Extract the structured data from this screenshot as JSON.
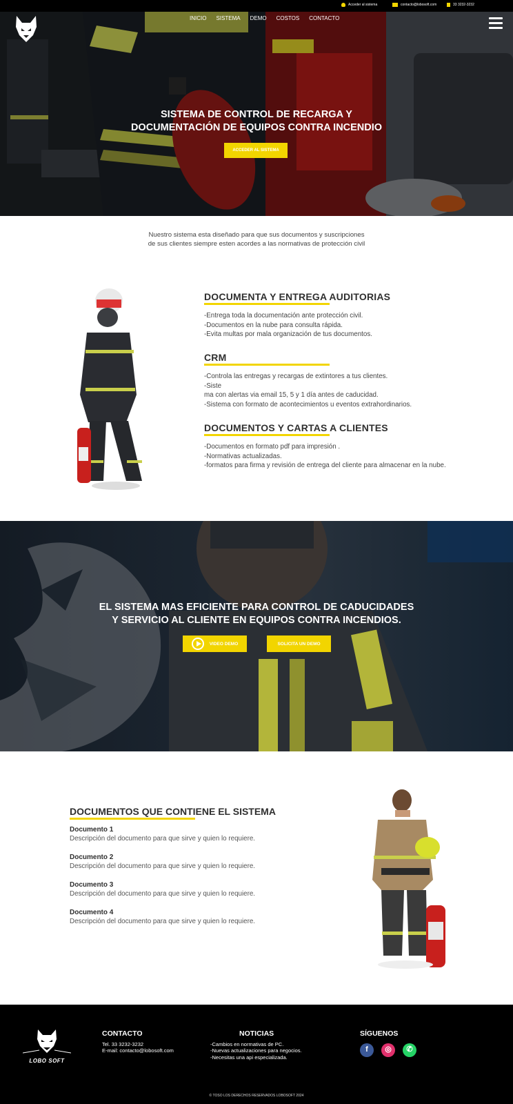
{
  "topbar": {
    "access": "Acceder al sistema",
    "email": "contacto@lobosoft.com",
    "phone": "33 3232-3232"
  },
  "nav": [
    "INICIO",
    "SISTEMA",
    "DEMO",
    "COSTOS",
    "CONTACTO"
  ],
  "hero": {
    "title_line1": "SISTEMA DE CONTROL DE RECARGA Y",
    "title_line2": "DOCUMENTACIÓN DE EQUIPOS CONTRA INCENDIO",
    "cta": "ACCEDER AL SISTEMA"
  },
  "intro": {
    "line1": "Nuestro sistema esta diseñado para que sus documentos y suscripciones",
    "line2": "de sus clientes siempre esten acordes a las normativas de protección civil"
  },
  "features": [
    {
      "title": "DOCUMENTA Y ENTREGA AUDITORIAS",
      "items": [
        "-Entrega toda la documentación ante protección civil.",
        "-Documentos en la nube para consulta rápida.",
        "-Evita multas por mala organización de tus documentos."
      ]
    },
    {
      "title": "CRM",
      "items": [
        "-Controla las entregas y recargas de extintores a tus clientes.",
        "-Siste",
        "ma con alertas via email 15, 5 y 1 día antes de caducidad.",
        "-Sistema con formato de acontecimientos u eventos extrahordinarios."
      ]
    },
    {
      "title": "DOCUMENTOS Y CARTAS A CLIENTES",
      "items": [
        "-Documentos en formato pdf para impresión .",
        "-Normativas actualizadas.",
        "-formatos para firma y revisión de entrega del cliente para almacenar en la nube."
      ]
    }
  ],
  "band": {
    "line1": "EL SISTEMA MAS EFICIENTE PARA CONTROL DE CADUCIDADES",
    "line2": "Y SERVICIO AL CLIENTE EN EQUIPOS CONTRA INCENDIOS.",
    "video_btn": "VIDEO DEMO",
    "demo_btn": "SOLICITA UN DEMO"
  },
  "docs": {
    "title": "DOCUMENTOS QUE CONTIENE EL SISTEMA",
    "items": [
      {
        "name": "Documento 1",
        "desc": "Descripción del documento para que sirve y quien lo requiere."
      },
      {
        "name": "Documento 2",
        "desc": "Descripción del documento para que sirve y quien lo requiere."
      },
      {
        "name": "Documento 3",
        "desc": "Descripción del documento para que sirve y quien lo requiere."
      },
      {
        "name": "Documento 4",
        "desc": "Descripción del documento para que sirve y quien lo requiere."
      }
    ]
  },
  "footer": {
    "logo_text": "LOBO SOFT",
    "contact_title": "CONTACTO",
    "contact_tel": "Tel. 33 3232-3232",
    "contact_email": "E-mail:  contacto@lobosoft.com",
    "news_title": "NOTICIAS",
    "news_items": [
      "-Cambios en normativas de PC.",
      "-Nuevas actualizaciones para negocios.",
      "-Necesitas una api especializada."
    ],
    "social_title": "SÍGUENOS",
    "copyright": "© TOSO LOS DERECHOS RESERVADOS LOBOSOFT 2024"
  },
  "colors": {
    "accent": "#f2d500",
    "dark": "#000000",
    "facebook": "#3b5998",
    "instagram": "#e1306c",
    "whatsapp": "#25d366"
  },
  "icons": [
    "user-icon",
    "mail-icon",
    "phone-icon",
    "menu-icon",
    "wolf-logo",
    "play-icon",
    "facebook-icon",
    "instagram-icon",
    "whatsapp-icon"
  ]
}
